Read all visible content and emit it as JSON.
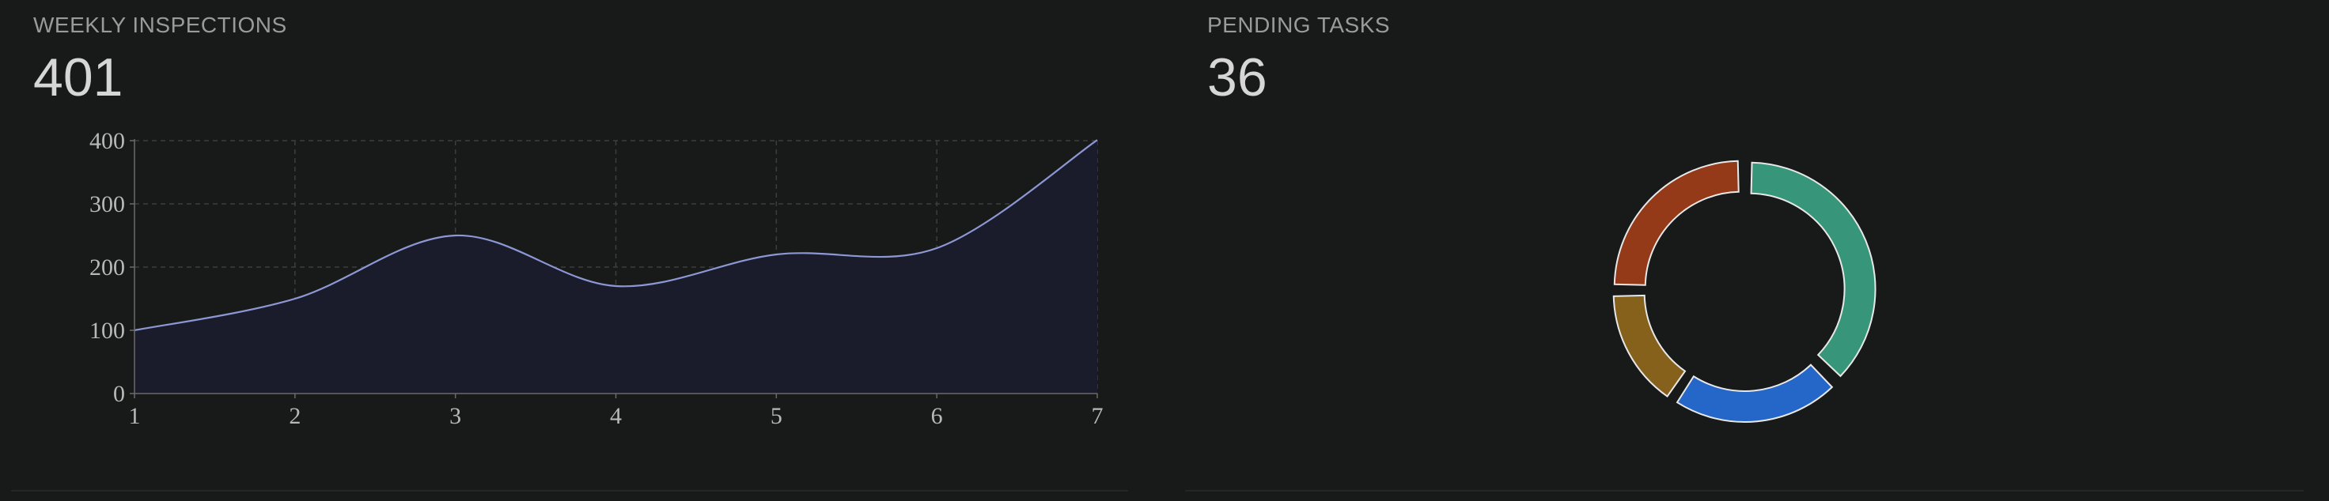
{
  "left_panel": {
    "title": "WEEKLY INSPECTIONS",
    "value": "401"
  },
  "right_panel": {
    "title": "PENDING TASKS",
    "value": "36"
  },
  "chart_data": [
    {
      "type": "area",
      "x": [
        1,
        2,
        3,
        4,
        5,
        6,
        7
      ],
      "y": [
        100,
        150,
        250,
        170,
        220,
        230,
        401
      ],
      "xlim": [
        1,
        7
      ],
      "ylim": [
        0,
        400
      ],
      "yticks": [
        0,
        100,
        200,
        300,
        400
      ],
      "xticks": [
        1,
        2,
        3,
        4,
        5,
        6,
        7
      ],
      "grid": true,
      "line_color": "#8d97d4",
      "fill_color": "#1b1c2b"
    },
    {
      "type": "pie",
      "values": [
        12,
        7,
        5,
        8
      ],
      "colors": [
        "#37967a",
        "#2566c9",
        "#86611b",
        "#943a18"
      ],
      "hole": true
    }
  ]
}
